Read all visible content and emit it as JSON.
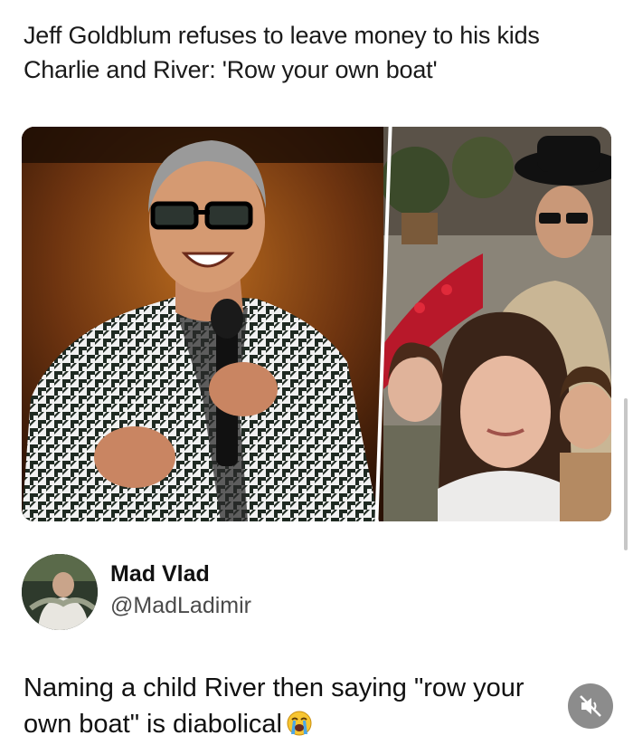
{
  "post": {
    "headline": "Jeff Goldblum refuses to leave money to his kids Charlie and River: 'Row your own boat'"
  },
  "tweet": {
    "display_name": "Mad Vlad",
    "handle": "@MadLadimir",
    "text": "Naming a child River then saying \"row your own boat\" is diabolical",
    "emoji": "loudly-crying-face"
  },
  "icons": {
    "mute": "speaker-muted-icon"
  },
  "colors": {
    "text_primary": "#111111",
    "text_secondary": "#4a4a4a",
    "mute_button_bg": "#787878"
  }
}
